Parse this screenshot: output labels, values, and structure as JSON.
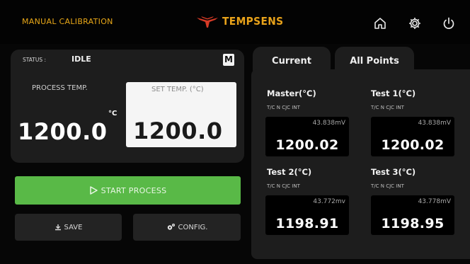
{
  "header": {
    "title": "MANUAL CALIBRATION",
    "logo_text": "TEMPSENS",
    "icons": [
      "home-icon",
      "gear-icon",
      "power-icon"
    ]
  },
  "status": {
    "label": "STATUS :",
    "value": "IDLE",
    "mode_badge": "M"
  },
  "process": {
    "label": "PROCESS TEMP.",
    "value": "1200.0",
    "unit": "°C"
  },
  "setpoint": {
    "label": "SET TEMP. (°C)",
    "value": "1200.0"
  },
  "buttons": {
    "start": "START PROCESS",
    "save": "SAVE",
    "config": "CONFIG."
  },
  "tabs": [
    {
      "label": "Current"
    },
    {
      "label": "All Points",
      "active": true
    }
  ],
  "channels": [
    {
      "title": "Master(°C)",
      "subtitle": "T/C N CJC INT",
      "mv": "43.838mV",
      "value": "1200.02"
    },
    {
      "title": "Test 1(°C)",
      "subtitle": "T/C N CJC INT",
      "mv": "43.838mV",
      "value": "1200.02"
    },
    {
      "title": "Test 2(°C)",
      "subtitle": "T/C N CJC INT",
      "mv": "43.772mv",
      "value": "1198.91"
    },
    {
      "title": "Test 3(°C)",
      "subtitle": "T/C N CJC INT",
      "mv": "43.778mV",
      "value": "1198.95"
    }
  ],
  "colors": {
    "accent_orange": "#e9a818",
    "logo_red": "#d63a26",
    "start_green": "#59b947",
    "panel": "#1d1d1d",
    "background": "#060606"
  }
}
